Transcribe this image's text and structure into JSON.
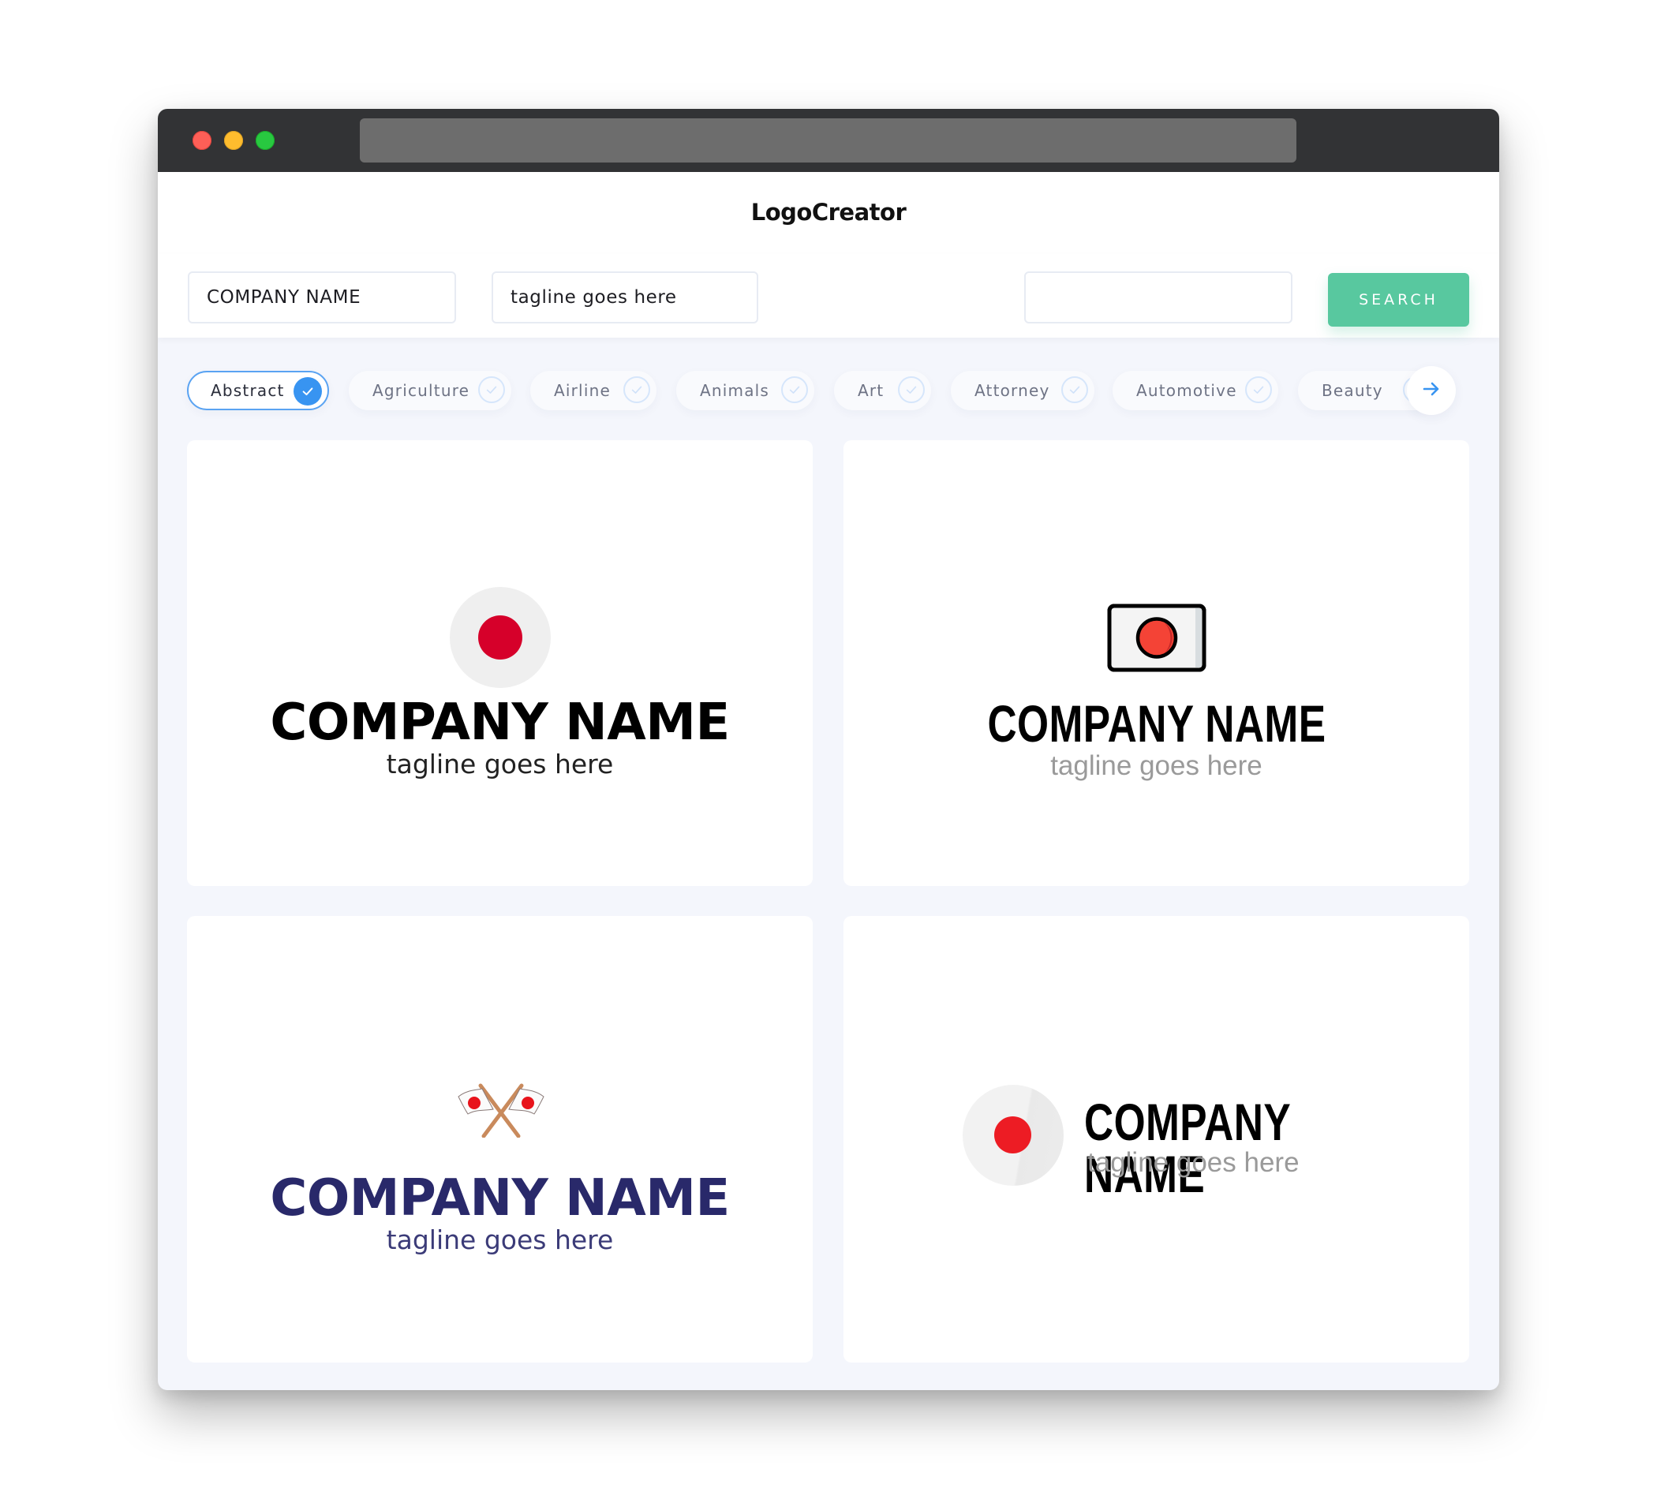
{
  "window": {
    "controls": [
      "close",
      "minimize",
      "maximize"
    ]
  },
  "header": {
    "brand": "LogoCreator"
  },
  "search": {
    "company_name_value": "COMPANY NAME",
    "tagline_value": "tagline goes here",
    "keyword_value": "",
    "button_label": "SEARCH"
  },
  "categories": {
    "items": [
      {
        "label": "Abstract",
        "selected": true
      },
      {
        "label": "Agriculture",
        "selected": false
      },
      {
        "label": "Airline",
        "selected": false
      },
      {
        "label": "Animals",
        "selected": false
      },
      {
        "label": "Art",
        "selected": false
      },
      {
        "label": "Attorney",
        "selected": false
      },
      {
        "label": "Automotive",
        "selected": false
      },
      {
        "label": "Beauty",
        "selected": false
      }
    ],
    "next_icon": "arrow-right-icon"
  },
  "colors": {
    "accent_green": "#58c89f",
    "accent_blue": "#3894f1",
    "logo_red": "#d6002a",
    "logo_navy": "#29296a"
  },
  "logos": [
    {
      "icon": "japan-flag-circle-icon",
      "company": "COMPANY NAME",
      "tagline": "tagline goes here",
      "name_color": "#000000",
      "tagline_color": "#222222"
    },
    {
      "icon": "japan-flag-rect-icon",
      "company": "COMPANY NAME",
      "tagline": "tagline goes here",
      "name_color": "#000000",
      "tagline_color": "#9a9a9a"
    },
    {
      "icon": "crossed-japan-flags-icon",
      "company": "COMPANY NAME",
      "tagline": "tagline goes here",
      "name_color": "#29296a",
      "tagline_color": "#3b3b78"
    },
    {
      "icon": "japan-flag-circle-icon",
      "company": "COMPANY NAME",
      "tagline": "tagline goes here",
      "name_color": "#000000",
      "tagline_color": "#9a9a9a"
    }
  ]
}
